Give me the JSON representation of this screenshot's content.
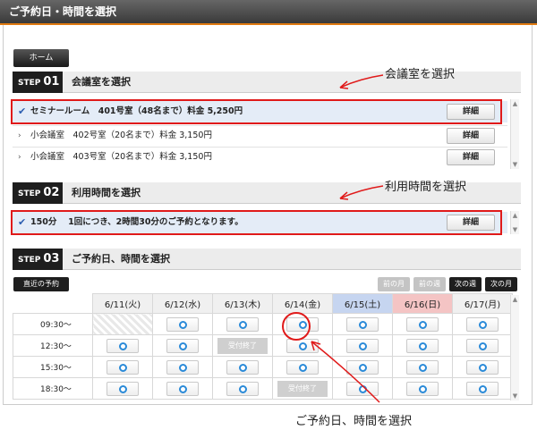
{
  "window": {
    "title": "ご予約日・時間を選択"
  },
  "home_button": "ホーム",
  "step1": {
    "label_step": "STEP",
    "label_num": "01",
    "title": "会議室を選択",
    "annotation": "会議室を選択",
    "rooms": [
      {
        "text": "セミナールーム　401号室（48名まで）料金 5,250円",
        "button": "詳細",
        "selected": true
      },
      {
        "text": "小会議室　402号室（20名まで）料金 3,150円",
        "button": "詳細",
        "selected": false
      },
      {
        "text": "小会議室　403号室（20名まで）料金 3,150円",
        "button": "詳細",
        "selected": false
      }
    ]
  },
  "step2": {
    "label_step": "STEP",
    "label_num": "02",
    "title": "利用時間を選択",
    "annotation": "利用時間を選択",
    "option": {
      "duration": "150分",
      "text": "1回につき、2時間30分のご予約となります。",
      "button": "詳細"
    }
  },
  "step3": {
    "label_step": "STEP",
    "label_num": "03",
    "title": "ご予約日、時間を選択",
    "annotation": "ご予約日、時間を選択",
    "recent_button": "直近の予約",
    "nav": {
      "prev_month": "前の月",
      "prev_week": "前の週",
      "next_week": "次の週",
      "next_month": "次の月"
    },
    "days": [
      "6/11(火)",
      "6/12(水)",
      "6/13(木)",
      "6/14(金)",
      "6/15(土)",
      "6/16(日)",
      "6/17(月)"
    ],
    "closed_label": "受付終了",
    "times": [
      "09:30～",
      "12:30～",
      "15:30～",
      "18:30～"
    ]
  },
  "colors": {
    "accent_orange": "#e07a10",
    "annotation_red": "#e01a1a",
    "saturday": "#c6d5f0",
    "sunday": "#f4c4c4",
    "slot_circle": "#2a8ad8"
  }
}
